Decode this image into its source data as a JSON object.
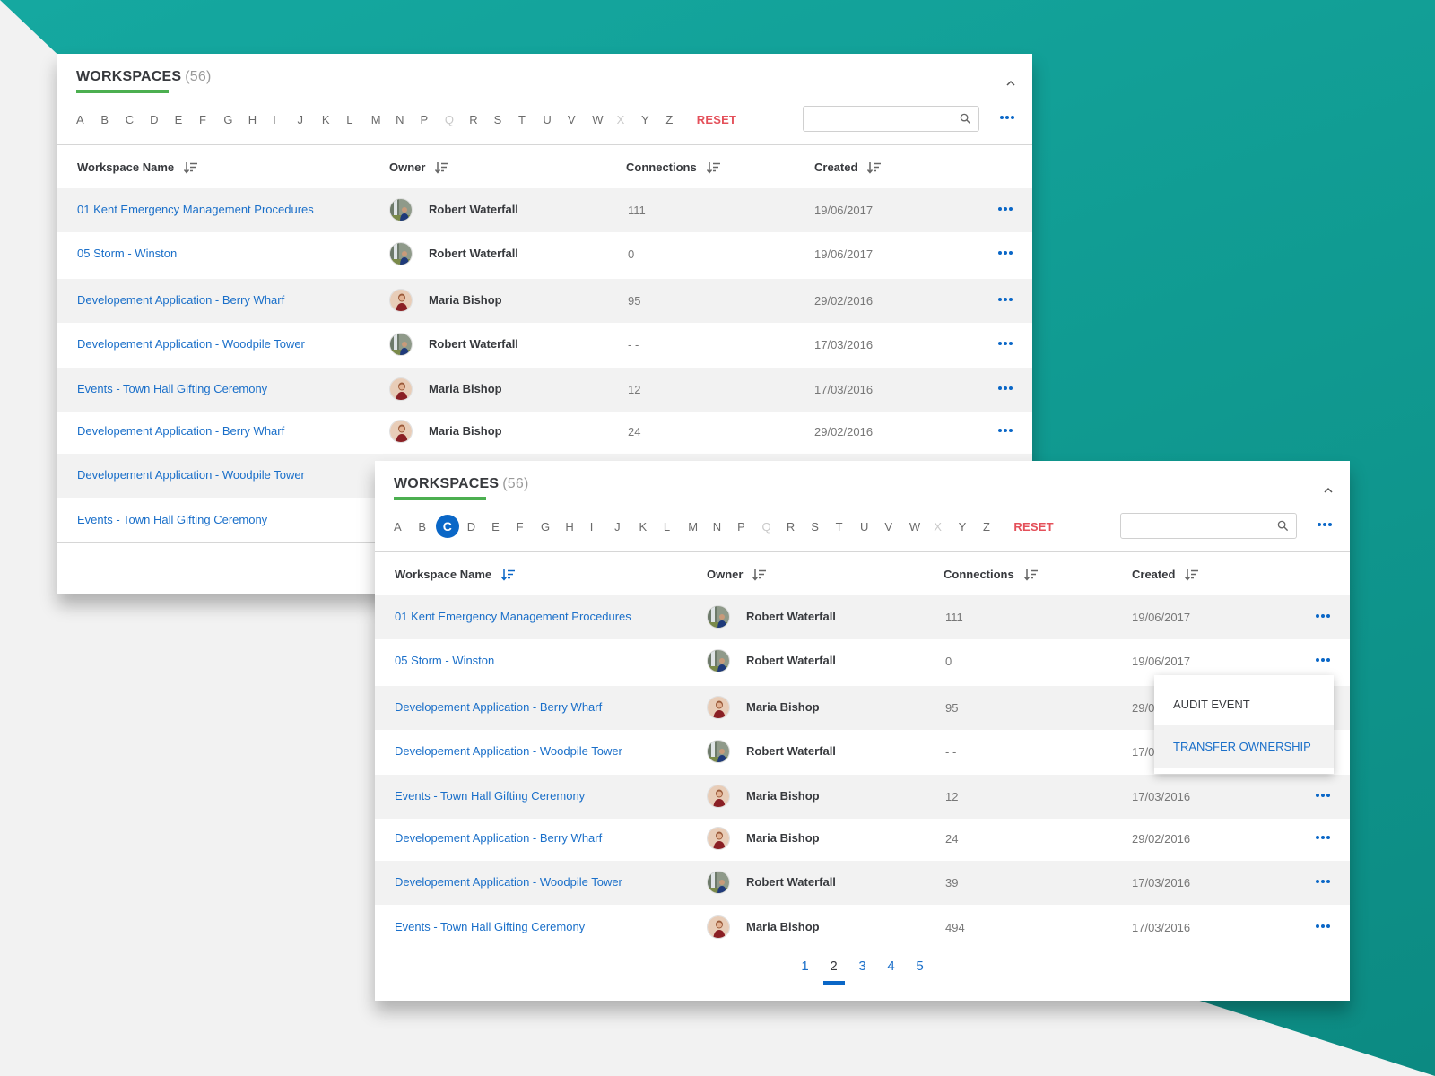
{
  "colors": {
    "accent": "#0a67c7",
    "link": "#1a6fc9",
    "reset": "#e4505a",
    "tab_underline": "#4caf50",
    "background_teal": "#109a91"
  },
  "panels": [
    {
      "title": "WORKSPACES",
      "count": "(56)",
      "alphabet": [
        {
          "l": "A"
        },
        {
          "l": "B"
        },
        {
          "l": "C"
        },
        {
          "l": "D"
        },
        {
          "l": "E"
        },
        {
          "l": "F"
        },
        {
          "l": "G"
        },
        {
          "l": "H"
        },
        {
          "l": "I"
        },
        {
          "l": "J"
        },
        {
          "l": "K"
        },
        {
          "l": "L"
        },
        {
          "l": "M"
        },
        {
          "l": "N"
        },
        {
          "l": "P"
        },
        {
          "l": "Q",
          "disabled": true
        },
        {
          "l": "R"
        },
        {
          "l": "S"
        },
        {
          "l": "T"
        },
        {
          "l": "U"
        },
        {
          "l": "V"
        },
        {
          "l": "W"
        },
        {
          "l": "X",
          "disabled": true
        },
        {
          "l": "Y"
        },
        {
          "l": "Z"
        }
      ],
      "selected_letter": null,
      "reset_label": "RESET",
      "search": {
        "value": "",
        "placeholder": ""
      },
      "columns": [
        "Workspace Name",
        "Owner",
        "Connections",
        "Created"
      ],
      "active_sort_column": null,
      "rows": [
        {
          "name": "01 Kent Emergency Management Procedures",
          "owner": "Robert Waterfall",
          "avatar": "robert",
          "connections": "111",
          "created": "19/06/2017"
        },
        {
          "name": "05 Storm - Winston",
          "owner": "Robert Waterfall",
          "avatar": "robert",
          "connections": "0",
          "created": "19/06/2017"
        },
        {
          "name": "Developement Application - Berry Wharf",
          "owner": "Maria Bishop",
          "avatar": "maria",
          "connections": "95",
          "created": "29/02/2016"
        },
        {
          "name": "Developement Application - Woodpile Tower",
          "owner": "Robert Waterfall",
          "avatar": "robert",
          "connections": "- -",
          "created": "17/03/2016"
        },
        {
          "name": "Events - Town Hall Gifting Ceremony",
          "owner": "Maria Bishop",
          "avatar": "maria",
          "connections": "12",
          "created": "17/03/2016"
        },
        {
          "name": "Developement Application - Berry Wharf",
          "owner": "Maria Bishop",
          "avatar": "maria",
          "connections": "24",
          "created": "29/02/2016"
        },
        {
          "name": "Developement Application - Woodpile Tower",
          "owner": "",
          "avatar": "",
          "connections": "",
          "created": ""
        },
        {
          "name": "Events - Town Hall Gifting Ceremony",
          "owner": "",
          "avatar": "",
          "connections": "",
          "created": ""
        }
      ]
    },
    {
      "title": "WORKSPACES",
      "count": "(56)",
      "alphabet": [
        {
          "l": "A"
        },
        {
          "l": "B"
        },
        {
          "l": "C",
          "selected": true
        },
        {
          "l": "D"
        },
        {
          "l": "E"
        },
        {
          "l": "F"
        },
        {
          "l": "G"
        },
        {
          "l": "H"
        },
        {
          "l": "I"
        },
        {
          "l": "J"
        },
        {
          "l": "K"
        },
        {
          "l": "L"
        },
        {
          "l": "M"
        },
        {
          "l": "N"
        },
        {
          "l": "P"
        },
        {
          "l": "Q",
          "disabled": true
        },
        {
          "l": "R"
        },
        {
          "l": "S"
        },
        {
          "l": "T"
        },
        {
          "l": "U"
        },
        {
          "l": "V"
        },
        {
          "l": "W"
        },
        {
          "l": "X",
          "disabled": true
        },
        {
          "l": "Y"
        },
        {
          "l": "Z"
        }
      ],
      "selected_letter": "C",
      "reset_label": "RESET",
      "search": {
        "value": "",
        "placeholder": ""
      },
      "columns": [
        "Workspace Name",
        "Owner",
        "Connections",
        "Created"
      ],
      "active_sort_column": "Workspace Name",
      "rows": [
        {
          "name": "01 Kent Emergency Management Procedures",
          "owner": "Robert Waterfall",
          "avatar": "robert",
          "connections": "111",
          "created": "19/06/2017"
        },
        {
          "name": "05 Storm - Winston",
          "owner": "Robert Waterfall",
          "avatar": "robert",
          "connections": "0",
          "created": "19/06/2017"
        },
        {
          "name": "Developement Application - Berry Wharf",
          "owner": "Maria Bishop",
          "avatar": "maria",
          "connections": "95",
          "created": "29/02/2016"
        },
        {
          "name": "Developement Application - Woodpile Tower",
          "owner": "Robert Waterfall",
          "avatar": "robert",
          "connections": "- -",
          "created": "17/03/2016"
        },
        {
          "name": "Events - Town Hall Gifting Ceremony",
          "owner": "Maria Bishop",
          "avatar": "maria",
          "connections": "12",
          "created": "17/03/2016"
        },
        {
          "name": "Developement Application - Berry Wharf",
          "owner": "Maria Bishop",
          "avatar": "maria",
          "connections": "24",
          "created": "29/02/2016"
        },
        {
          "name": "Developement Application - Woodpile Tower",
          "owner": "Robert Waterfall",
          "avatar": "robert",
          "connections": "39",
          "created": "17/03/2016"
        },
        {
          "name": "Events - Town Hall Gifting Ceremony",
          "owner": "Maria Bishop",
          "avatar": "maria",
          "connections": "494",
          "created": "17/03/2016"
        }
      ],
      "pagination": {
        "pages": [
          "1",
          "2",
          "3",
          "4",
          "5"
        ],
        "current": "2"
      }
    }
  ],
  "context_menu": {
    "items": [
      {
        "label": "AUDIT EVENT"
      },
      {
        "label": "TRANSFER OWNERSHIP",
        "highlighted": true
      }
    ]
  }
}
